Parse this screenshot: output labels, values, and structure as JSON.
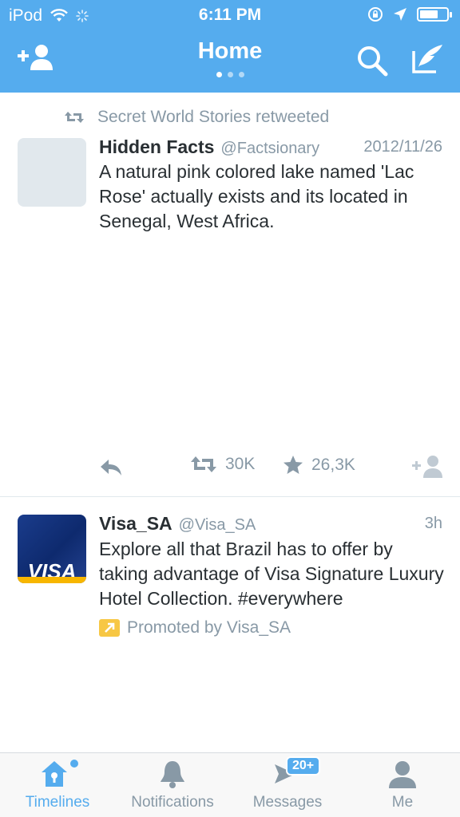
{
  "status_bar": {
    "carrier": "iPod",
    "time": "6:11 PM"
  },
  "nav": {
    "title": "Home",
    "add_user_icon": "add-user-icon",
    "search_icon": "search-icon",
    "compose_icon": "compose-icon",
    "page_dots": 3,
    "active_dot": 1
  },
  "tweets": [
    {
      "retweeted_by": "Secret World Stories retweeted",
      "name": "Hidden Facts",
      "handle": "@Factsionary",
      "date": "2012/11/26",
      "text": "A natural pink colored lake named 'Lac Rose' actually exists and its located in Senegal, West Africa.",
      "retweets": "30K",
      "favorites": "26,3K"
    },
    {
      "name": "Visa_SA",
      "handle": "@Visa_SA",
      "date": "3h",
      "avatar_text": "VISA",
      "text": "Explore all that Brazil has to offer by taking advantage of Visa Signature Luxury Hotel Collection. #everywhere",
      "promoted": "Promoted by Visa_SA"
    }
  ],
  "tabbar": {
    "tabs": [
      {
        "label": "Timelines",
        "icon": "home-icon",
        "active": true
      },
      {
        "label": "Notifications",
        "icon": "bell-icon",
        "active": false
      },
      {
        "label": "Messages",
        "icon": "messages-icon",
        "active": false,
        "badge": "20+"
      },
      {
        "label": "Me",
        "icon": "person-icon",
        "active": false
      }
    ]
  },
  "colors": {
    "brand": "#55acee",
    "muted": "#8899a6",
    "text": "#292f33",
    "visa_blue": "#1a3c8c",
    "promoted_yellow": "#f7c744"
  }
}
